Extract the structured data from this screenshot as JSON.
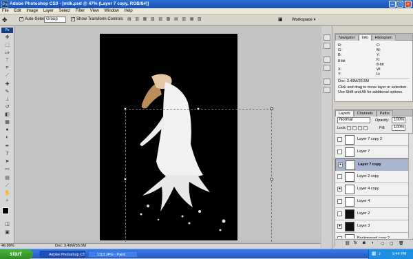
{
  "titlebar": {
    "app_icon": "Ps",
    "title": "Adobe Photoshop CS3 - [milk.psd @ 47% (Layer 7 copy, RGB/8#)]"
  },
  "menu": {
    "items": [
      "File",
      "Edit",
      "Image",
      "Layer",
      "Select",
      "Filter",
      "View",
      "Window",
      "Help"
    ]
  },
  "options": {
    "auto_select_label": "Auto-Select:",
    "auto_select_value": "Group",
    "transform_label": "Show Transform Controls",
    "workspace_label": "Workspace ▾"
  },
  "panels": {
    "top_tabs": [
      "Navigator",
      "Info",
      "Histogram"
    ],
    "info": {
      "r": "R:",
      "g": "G:",
      "b": "B:",
      "c": "C:",
      "m": "M:",
      "y": "Y:",
      "k": "K:",
      "bit1": "8-bit",
      "bit2": "8-bit",
      "x": "X:",
      "yy": "Y:",
      "w": "W:",
      "h": "H:",
      "doc": "Doc: 3.49M/35.5M",
      "help": "Click and drag to move layer or selection. Use Shift and Alt for additional options."
    },
    "layer_tabs": [
      "Layers",
      "Channels",
      "Paths"
    ],
    "blend_mode": "Normal",
    "opacity_label": "Opacity:",
    "opacity_value": "100%",
    "lock_label": "Lock:",
    "fill_label": "Fill:",
    "fill_value": "100%",
    "layers": [
      {
        "name": "Layer 7 copy 2",
        "visible": false,
        "dark": false,
        "selected": false
      },
      {
        "name": "Layer 7",
        "visible": false,
        "dark": false,
        "selected": false
      },
      {
        "name": "Layer 7 copy",
        "visible": true,
        "dark": false,
        "selected": true
      },
      {
        "name": "Layer 2 copy",
        "visible": false,
        "dark": false,
        "selected": false
      },
      {
        "name": "Layer 4 copy",
        "visible": true,
        "dark": false,
        "selected": false
      },
      {
        "name": "Layer 4",
        "visible": false,
        "dark": false,
        "selected": false
      },
      {
        "name": "Layer 2",
        "visible": false,
        "dark": true,
        "selected": false
      },
      {
        "name": "Layer 3",
        "visible": true,
        "dark": true,
        "selected": false
      },
      {
        "name": "Background copy 2",
        "visible": false,
        "dark": false,
        "selected": false
      }
    ]
  },
  "status": {
    "zoom": "46.99%",
    "doc": "Doc: 3.49M/35.5M"
  },
  "taskbar": {
    "start": "start",
    "tasks": [
      "Adobe Photoshop CS3 ...",
      "1113.JPG - Paint"
    ],
    "clock": "9:44 PM"
  }
}
